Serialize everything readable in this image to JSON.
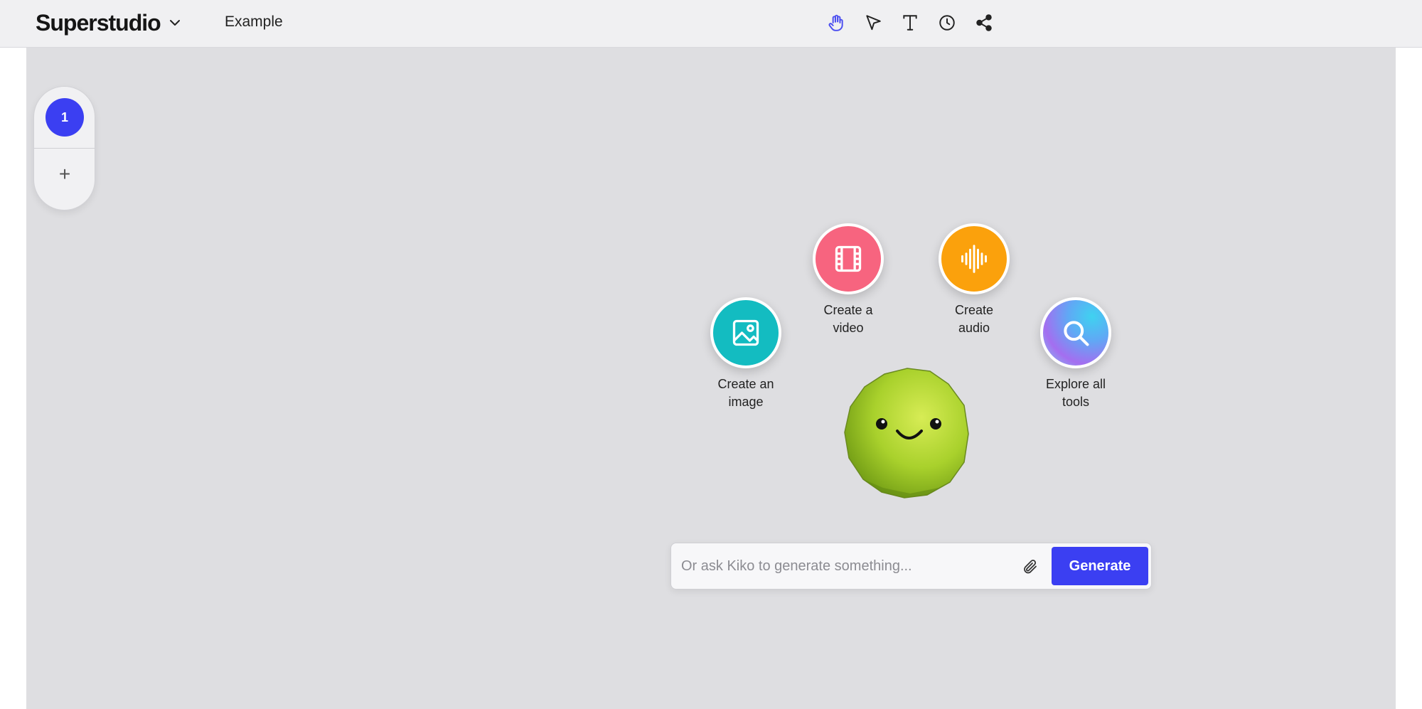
{
  "app": {
    "brand": "Superstudio",
    "project_name": "Example"
  },
  "toolbar": {
    "tools": [
      {
        "name": "hand-tool",
        "icon": "hand-icon",
        "active": true
      },
      {
        "name": "select-tool",
        "icon": "cursor-arrow-icon",
        "active": false
      },
      {
        "name": "text-tool",
        "icon": "text-icon",
        "active": false
      },
      {
        "name": "history-tool",
        "icon": "clock-icon",
        "active": false
      },
      {
        "name": "share-tool",
        "icon": "share-icon",
        "active": false
      }
    ],
    "active_color": "#4a4df0"
  },
  "pages": {
    "current": "1",
    "add_label": "+"
  },
  "actions": {
    "image": {
      "line1": "Create an",
      "line2": "image",
      "icon": "image-icon",
      "color": "#13bcc1"
    },
    "video": {
      "line1": "Create a",
      "line2": "video",
      "icon": "film-icon",
      "color": "#f7647f"
    },
    "audio": {
      "line1": "Create",
      "line2": "audio",
      "icon": "waveform-icon",
      "color": "#fba10c"
    },
    "explore": {
      "line1": "Explore all",
      "line2": "tools",
      "icon": "search-icon",
      "color": "gradient"
    }
  },
  "prompt": {
    "placeholder": "Or ask Kiko to generate something...",
    "value": "",
    "generate_label": "Generate"
  },
  "colors": {
    "accent": "#3b3ff2",
    "canvas": "#dedee1",
    "topbar": "#f0f0f2"
  }
}
